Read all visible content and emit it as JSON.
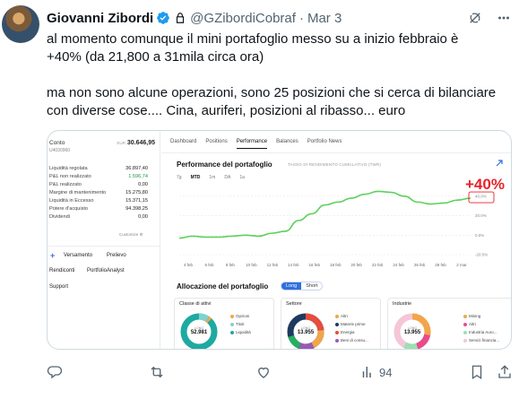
{
  "tweet": {
    "author_name": "Giovanni Zibordi",
    "handle": "@GZibordiCobraf",
    "separator": "·",
    "date": "Mar 3",
    "text_line1": "al momento comunque il mini portafoglio messo su a inizio febbraio è",
    "text_line2": "+40% (da 21,800 a 31mila circa ora)",
    "text_line3": "ma non sono alcune operazioni, sono 25 posizioni che si cerca di bilanciare",
    "text_line4": "con diverse cose.... Cina, auriferi, posizioni al ribasso... euro"
  },
  "stats": {
    "views": "94"
  },
  "icons": {
    "verified": "verified-badge-icon",
    "lock": "lock-icon",
    "grok": "grok-icon",
    "more": "more-icon",
    "reply": "reply-icon",
    "retweet": "retweet-icon",
    "like": "like-icon",
    "views": "views-icon",
    "bookmark": "bookmark-icon",
    "share": "share-icon"
  },
  "colors": {
    "accent": "#1d9bf0",
    "chart_line": "#5bd15b",
    "annotation_red": "#e8222a",
    "ib_blue": "#2f6fde"
  },
  "screenshot": {
    "account": {
      "label": "Conto",
      "id": "U4030960",
      "currency": "EUR",
      "balance": "30.646,95",
      "rows": [
        {
          "label": "Liquidità regolata",
          "value": "36.897,40"
        },
        {
          "label": "P&L non realizzato",
          "value": "1.596,74"
        },
        {
          "label": "P&L realizzato",
          "value": "0,00"
        },
        {
          "label": "Margine di mantenimento",
          "value": "15.275,80"
        },
        {
          "label": "Liquidità in Eccesso",
          "value": "15.371,15"
        },
        {
          "label": "Potere d'acquisto",
          "value": "94.398,25"
        },
        {
          "label": "Dividendi",
          "value": "0,00"
        }
      ],
      "customize": "Customize ⚙",
      "buttons": {
        "plus": "+",
        "deposit": "Versamento",
        "withdraw": "Prelievo",
        "reports": "Rendiconti",
        "analyst": "PortfolioAnalyst",
        "support": "Support"
      }
    },
    "tabs": [
      "Dashboard",
      "Positions",
      "Performance",
      "Balances",
      "Portfolio News"
    ],
    "active_tab": "Performance",
    "performance": {
      "title": "Performance del portafoglio",
      "subtitle": "TASSO DI RENDIMENTO CUMULATIVO (TWR)",
      "ranges": [
        "7g",
        "MTD",
        "1m",
        "DA",
        "1a"
      ],
      "selected_range": "MTD",
      "annotation": "+40%"
    },
    "allocation": {
      "title": "Allocazione del portafoglio",
      "toggle": [
        "Long",
        "Short"
      ],
      "cards": [
        {
          "header": "Classe di attivi",
          "center_small": "LONG",
          "center": "52.981",
          "legend": [
            "Opzioni",
            "Titoli",
            "Liquidità"
          ]
        },
        {
          "header": "Settore",
          "center_small": "LONG",
          "center": "13.955",
          "legend": [
            "Altri",
            "Materie prime",
            "Energia",
            "Beni di consu..."
          ]
        },
        {
          "header": "Industrie",
          "center_small": "LONG",
          "center": "13.955",
          "legend": [
            "Mining",
            "Altri",
            "Industria Auro...",
            "Servizi finanzia..."
          ]
        }
      ]
    }
  },
  "chart_data": {
    "type": "line",
    "title": "Performance del portafoglio",
    "subtitle": "TASSO DI RENDIMENTO CUMULATIVO (TWR)",
    "x": [
      "4 feb",
      "6 feb",
      "8 feb",
      "10 feb",
      "12 feb",
      "14 feb",
      "16 feb",
      "18 feb",
      "20 feb",
      "22 feb",
      "24 feb",
      "26 feb",
      "28 feb",
      "2 mar"
    ],
    "y_ticks": [
      "40.0%",
      "20.0%",
      "0.0%",
      "-20.0%"
    ],
    "ylim": [
      -20,
      50
    ],
    "series": [
      {
        "values": [
          -3,
          -1,
          -2,
          -2,
          -1,
          0,
          -1,
          2,
          4,
          15,
          22,
          31,
          34,
          38,
          42,
          45,
          44,
          40,
          34,
          32,
          33,
          36,
          38
        ]
      }
    ],
    "annotation": "+40%",
    "grid": true
  }
}
